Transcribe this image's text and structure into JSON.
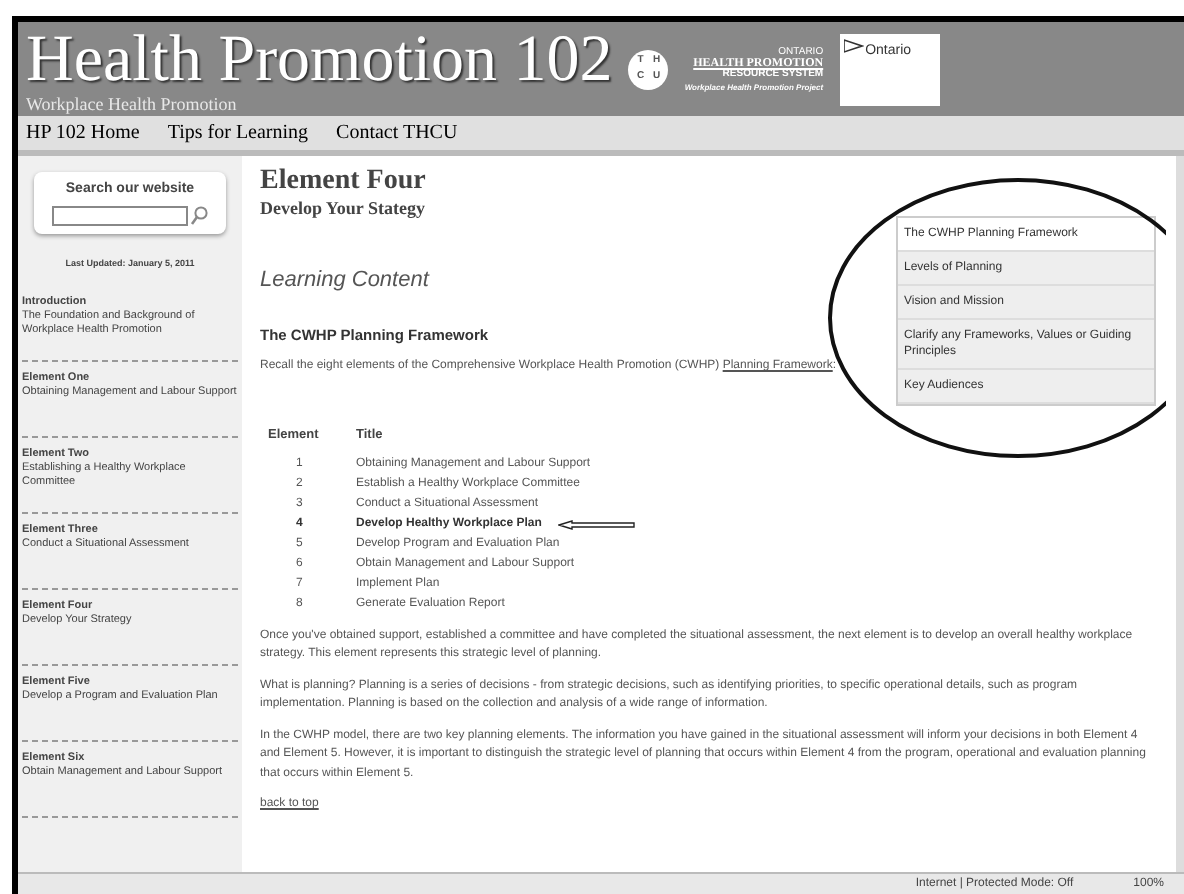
{
  "header": {
    "title": "Health Promotion 102",
    "subtitle": "Workplace Health Promotion",
    "badge_letters": [
      "T",
      "H",
      "C",
      "U"
    ],
    "partner": {
      "line_1": "ONTARIO",
      "line_2": "HEALTH PROMOTION",
      "line_3": "RESOURCE SYSTEM",
      "line_4": "Workplace Health Promotion Project"
    },
    "ontario_logo": "Ontario"
  },
  "nav": [
    "HP 102 Home",
    "Tips for Learning",
    "Contact THCU"
  ],
  "sidebar": {
    "search_label": "Search our website",
    "last_updated": "Last Updated: January 5, 2011",
    "items": [
      {
        "title": "Introduction",
        "subtitle": "The Foundation and Background of Workplace Health Promotion"
      },
      {
        "title": "Element One",
        "subtitle": "Obtaining Management and Labour Support"
      },
      {
        "title": "Element Two",
        "subtitle": "Establishing a Healthy Workplace Committee"
      },
      {
        "title": "Element Three",
        "subtitle": "Conduct a Situational Assessment"
      },
      {
        "title": "Element Four",
        "subtitle": "Develop Your Strategy"
      },
      {
        "title": "Element Five",
        "subtitle": "Develop a Program and Evaluation Plan"
      },
      {
        "title": "Element Six",
        "subtitle": "Obtain Management and Labour Support"
      }
    ]
  },
  "page": {
    "title": "Element Four",
    "subtitle": "Develop Your Stategy",
    "section": "Learning Content",
    "heading": "The CWHP Planning Framework",
    "intro": "Recall the eight elements of the Comprehensive Workplace Health Promotion (CWHP)",
    "intro_link": "Planning Framework",
    "intro_end": ":",
    "table": {
      "columns": [
        "Element",
        "Title"
      ],
      "rows": [
        {
          "number": "1",
          "title": "Obtaining Management and Labour Support",
          "selected": false
        },
        {
          "number": "2",
          "title": "Establish a Healthy Workplace Committee",
          "selected": false
        },
        {
          "number": "3",
          "title": "Conduct a Situational Assessment",
          "selected": false
        },
        {
          "number": "4",
          "title": "Develop Healthy Workplace Plan",
          "selected": true
        },
        {
          "number": "5",
          "title": "Develop Program and Evaluation Plan",
          "selected": false
        },
        {
          "number": "6",
          "title": "Obtain Management and Labour Support",
          "selected": false
        },
        {
          "number": "7",
          "title": "Implement Plan",
          "selected": false
        },
        {
          "number": "8",
          "title": "Generate Evaluation Report",
          "selected": false
        }
      ]
    },
    "paragraphs": [
      "Once you've obtained support, established a committee and have completed the situational assessment, the next element is to develop an overall healthy workplace strategy. This element represents this strategic level of planning.",
      "What is planning? Planning is a series of decisions - from strategic decisions, such as identifying priorities, to specific operational details, such as program implementation. Planning is based on the collection and analysis of a wide range of information.",
      "In the CWHP model, there are two key planning elements. The information you have gained in the situational assessment will inform your decisions in both Element 4 and Element 5. However, it is important to distinguish the strategic level of planning that occurs within Element 4 from the program, operational and evaluation planning that occurs within Element 5."
    ],
    "back_link": "back to top",
    "page_menu": [
      "The CWHP Planning Framework",
      "Levels of Planning",
      "Vision and Mission",
      "Clarify any Frameworks, Values or Guiding Principles",
      "Key Audiences"
    ]
  },
  "status_bar": {
    "zone": "Internet | Protected Mode: Off",
    "zoom": "100%"
  }
}
